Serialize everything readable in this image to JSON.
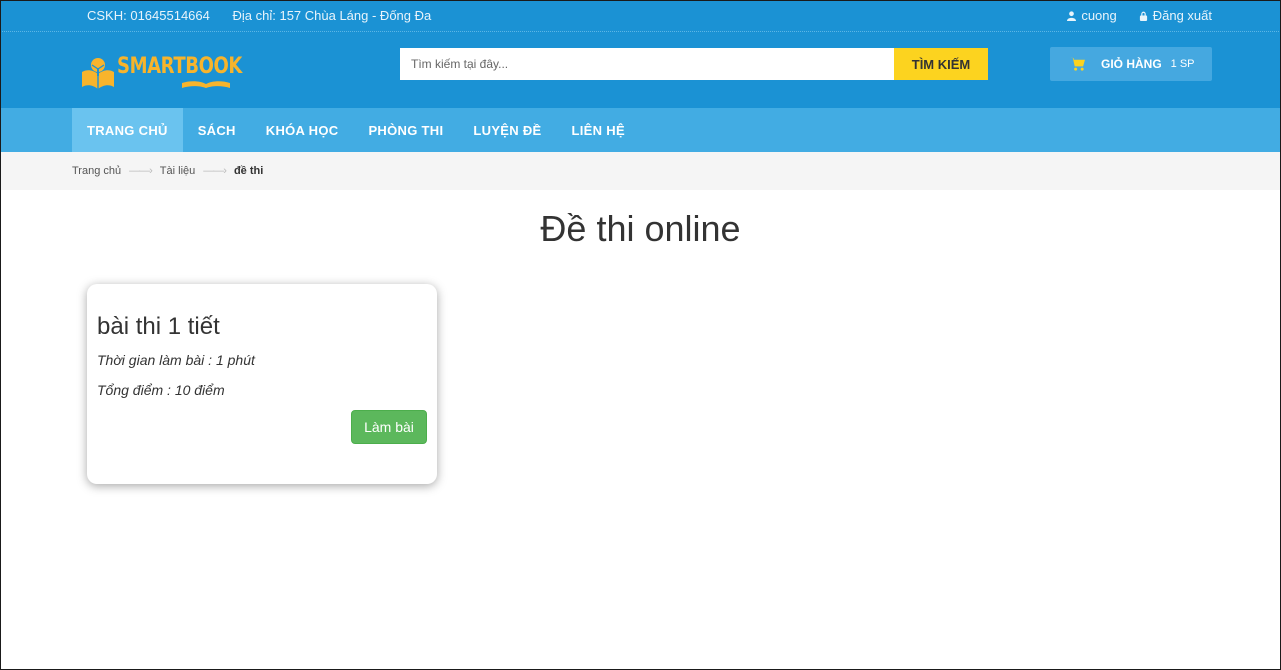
{
  "topbar": {
    "hotline": "CSKH: 01645514664",
    "address": "Địa chỉ: 157 Chùa Láng - Đống Đa",
    "user_name": "cuong",
    "logout_label": "Đăng xuất"
  },
  "header": {
    "logo_text": "SMARTBOOK",
    "search_placeholder": "Tìm kiếm tại đây...",
    "search_button": "TÌM KIẾM",
    "cart_label": "GIỎ HÀNG",
    "cart_count": "1 SP"
  },
  "nav": {
    "items": [
      {
        "label": "TRANG CHỦ",
        "active": true
      },
      {
        "label": "SÁCH"
      },
      {
        "label": "KHÓA HỌC"
      },
      {
        "label": "PHÒNG THI"
      },
      {
        "label": "LUYỆN ĐỀ"
      },
      {
        "label": "LIÊN HỆ"
      }
    ]
  },
  "breadcrumb": {
    "items": [
      "Trang chủ",
      "Tài liệu",
      "đề thi"
    ],
    "separator": "——›"
  },
  "page": {
    "title": "Đề thi online"
  },
  "exams": [
    {
      "title": "bài thi 1 tiết",
      "duration": "Thời gian làm bài : 1 phút",
      "total_score": "Tổng điểm : 10 điểm",
      "action_label": "Làm bài"
    }
  ],
  "colors": {
    "primary": "#1b92d4",
    "nav": "#42ace3",
    "nav_active": "#6ac3ef",
    "accent_yellow": "#fcd31f",
    "logo": "#f7b42c",
    "success": "#5cb85c"
  },
  "icons": {
    "user": "user-icon",
    "lock": "lock-icon",
    "cart": "shopping-cart-icon",
    "logo": "open-book-tree-logo"
  }
}
